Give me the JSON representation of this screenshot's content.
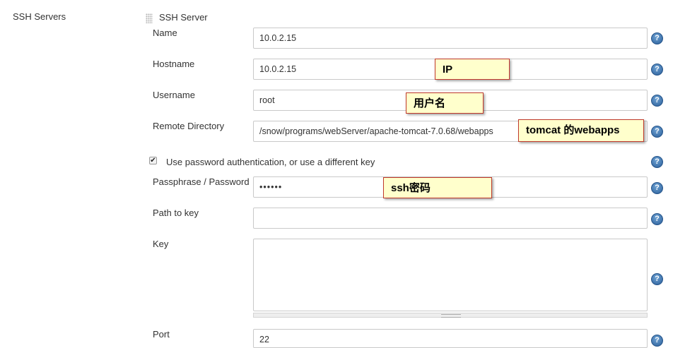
{
  "section": {
    "label": "SSH Servers"
  },
  "server_block": {
    "title": "SSH Server"
  },
  "fields": {
    "name": {
      "label": "Name",
      "value": "10.0.2.15"
    },
    "hostname": {
      "label": "Hostname",
      "value": "10.0.2.15"
    },
    "username": {
      "label": "Username",
      "value": "root"
    },
    "remote_directory": {
      "label": "Remote Directory",
      "value": "/snow/programs/webServer/apache-tomcat-7.0.68/webapps"
    },
    "use_password": {
      "label": "Use password authentication, or use a different key",
      "checked": true
    },
    "passphrase": {
      "label": "Passphrase / Password",
      "value": "••••••"
    },
    "path_to_key": {
      "label": "Path to key",
      "value": ""
    },
    "key": {
      "label": "Key",
      "value": ""
    },
    "port": {
      "label": "Port",
      "value": "22"
    }
  },
  "help": {
    "glyph": "?"
  },
  "checkbox_glyph": "✔",
  "annotations": {
    "ip": "IP",
    "username": "用户名",
    "webapps": "tomcat 的webapps",
    "password": "ssh密码"
  },
  "colors": {
    "note_bg": "#ffffcc",
    "note_border": "#c0392b",
    "help_blue": "#2a5e99"
  }
}
